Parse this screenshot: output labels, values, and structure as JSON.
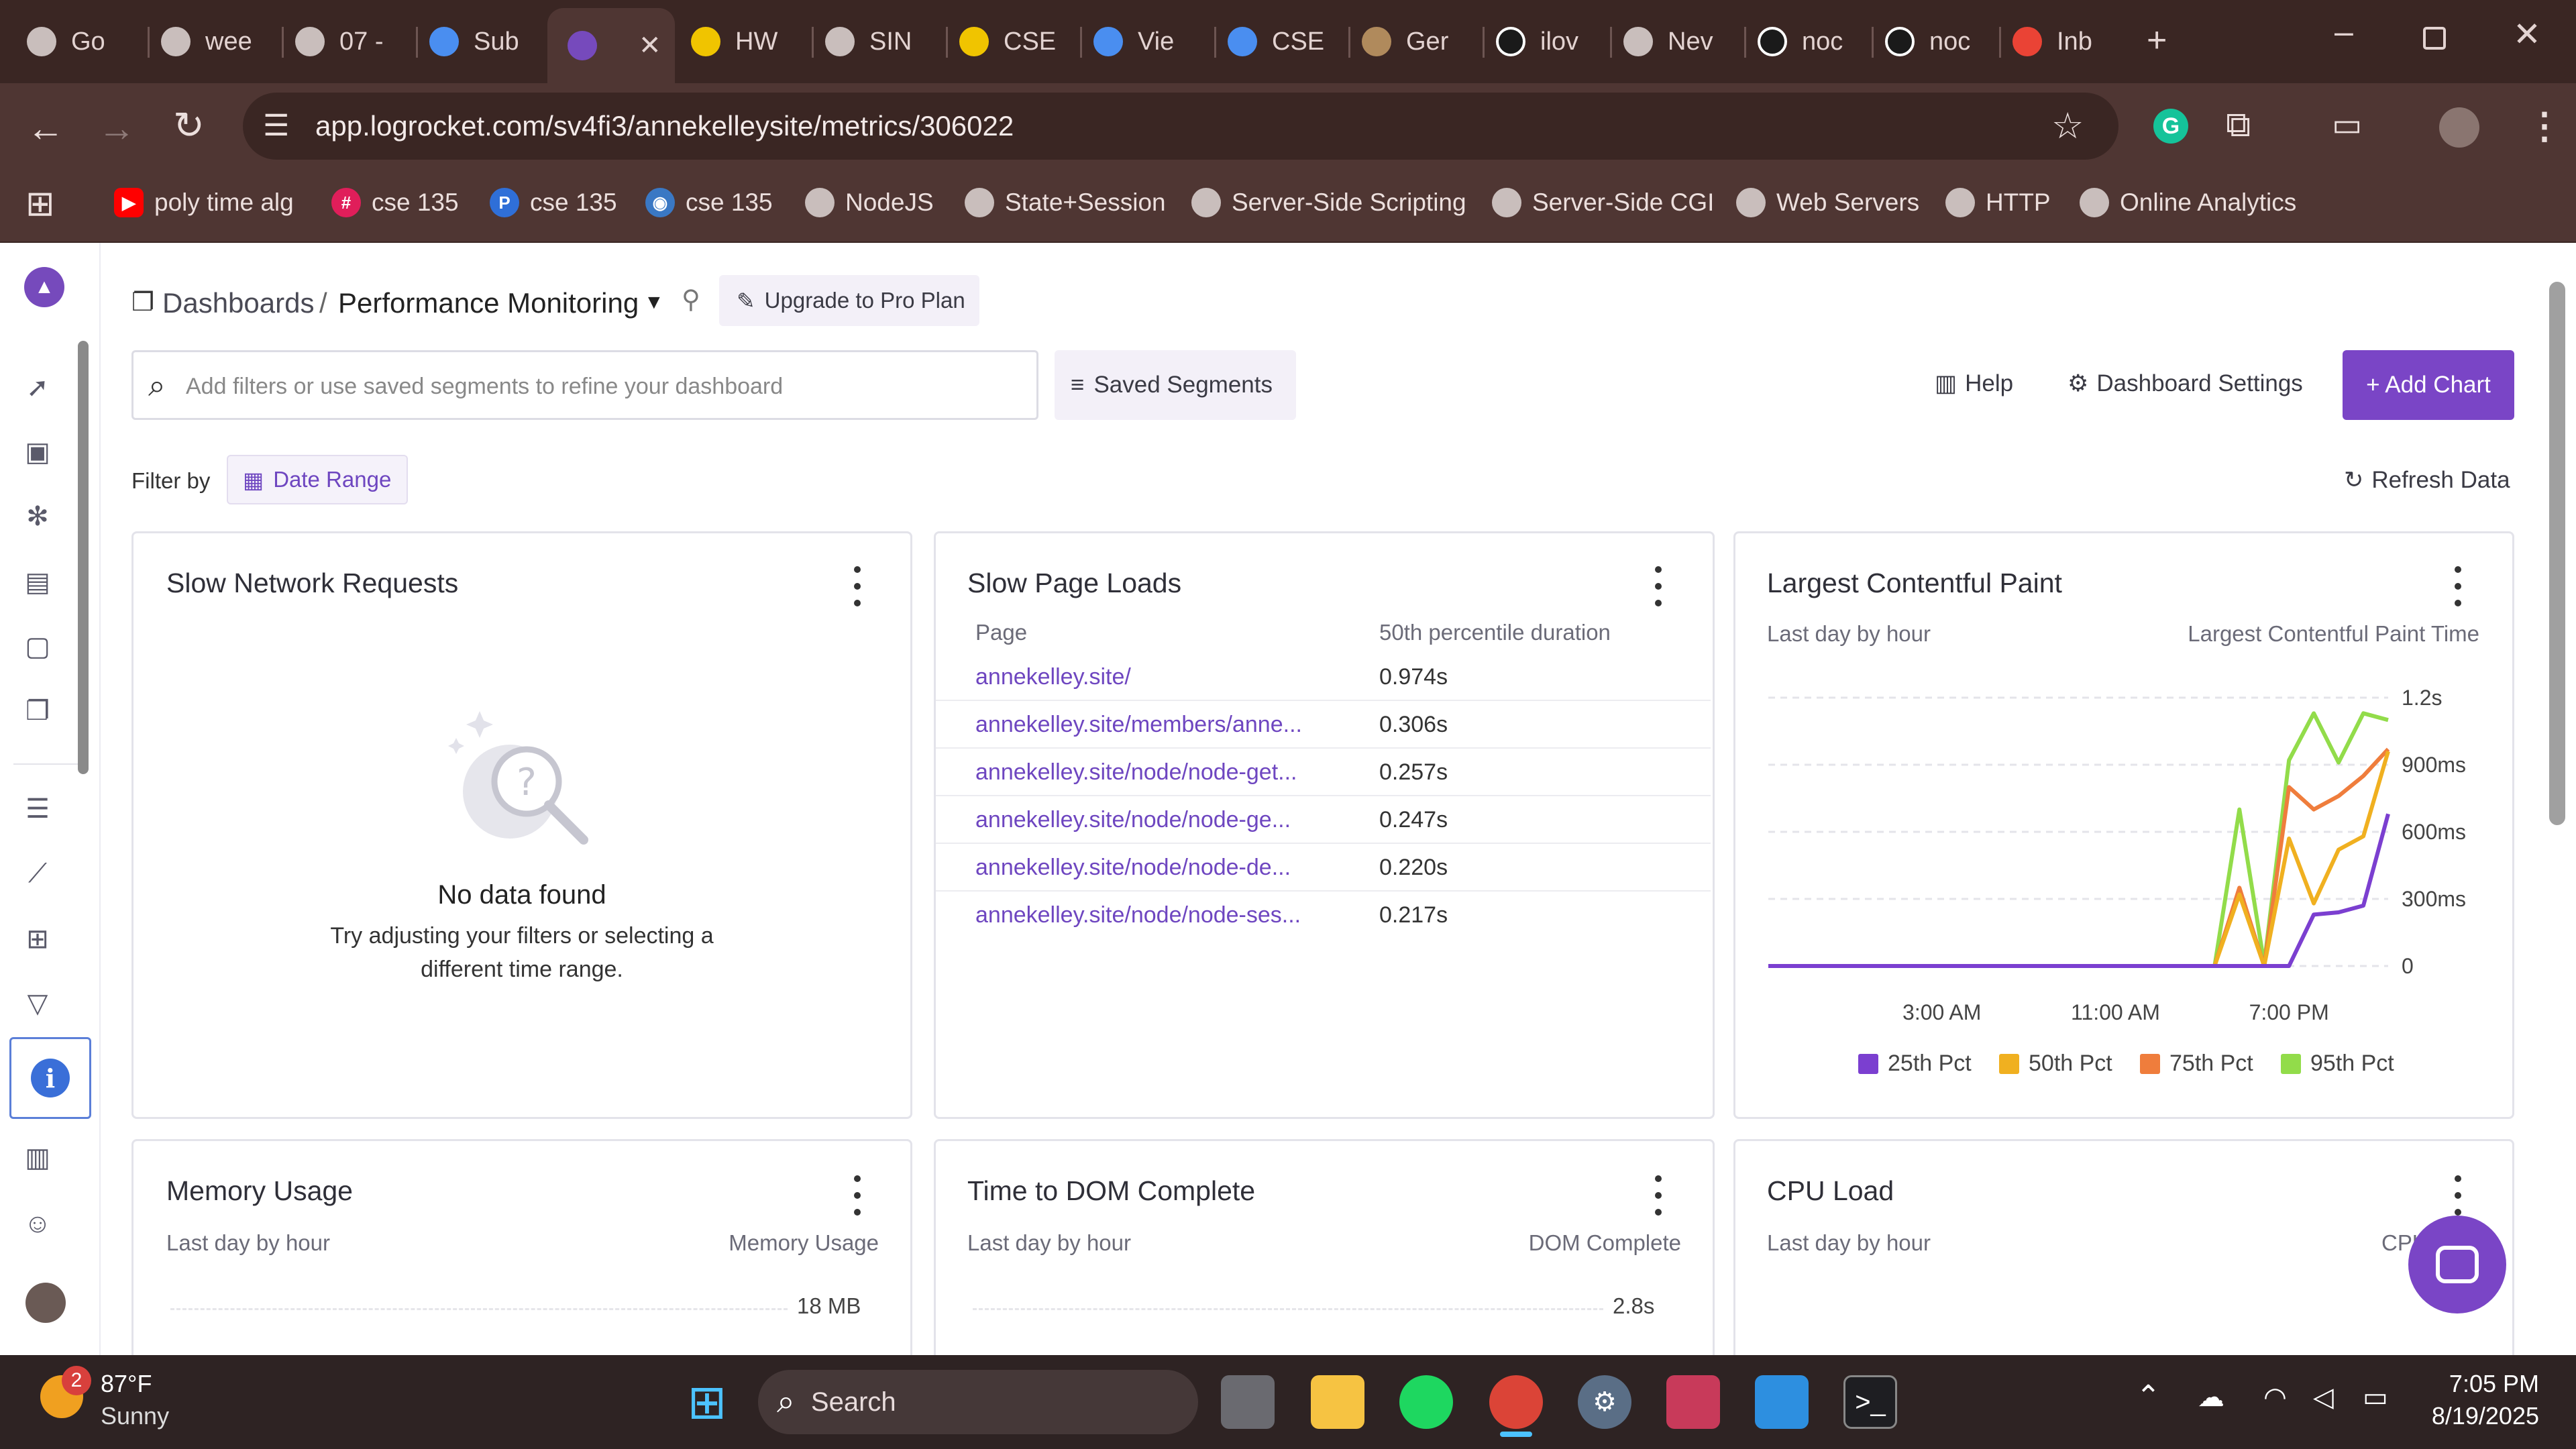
{
  "browser": {
    "tabs": [
      {
        "label": "Go",
        "icon": "globe-icon"
      },
      {
        "label": "wee",
        "icon": "globe-icon"
      },
      {
        "label": "07 -",
        "icon": "globe-icon"
      },
      {
        "label": "Sub",
        "icon": "bar-chart-icon"
      },
      {
        "label": "",
        "icon": "rocket-icon",
        "active": true
      },
      {
        "label": "HW",
        "icon": "stripes-icon"
      },
      {
        "label": "SIN",
        "icon": "globe-icon"
      },
      {
        "label": "CSE",
        "icon": "stripes-icon"
      },
      {
        "label": "Vie",
        "icon": "bar-chart-icon"
      },
      {
        "label": "CSE",
        "icon": "doc-icon"
      },
      {
        "label": "Ger",
        "icon": "image-icon"
      },
      {
        "label": "ilov",
        "icon": "github-icon"
      },
      {
        "label": "Nev",
        "icon": "chrome-icon"
      },
      {
        "label": "noc",
        "icon": "github-icon"
      },
      {
        "label": "noc",
        "icon": "github-icon"
      },
      {
        "label": "Inb",
        "icon": "gmail-icon"
      }
    ],
    "url": "app.logrocket.com/sv4fi3/annekelleysite/metrics/306022",
    "bookmarks": [
      {
        "label": "poly time alg",
        "icon": "youtube-icon"
      },
      {
        "label": "cse 135",
        "icon": "slack-icon"
      },
      {
        "label": "cse 135",
        "icon": "p-icon"
      },
      {
        "label": "cse 135",
        "icon": "site-icon"
      },
      {
        "label": "NodeJS",
        "icon": "globe-icon"
      },
      {
        "label": "State+Session",
        "icon": "globe-icon"
      },
      {
        "label": "Server-Side Scripting",
        "icon": "globe-icon"
      },
      {
        "label": "Server-Side CGI",
        "icon": "globe-icon"
      },
      {
        "label": "Web Servers",
        "icon": "globe-icon"
      },
      {
        "label": "HTTP",
        "icon": "globe-icon"
      },
      {
        "label": "Online Analytics",
        "icon": "globe-icon"
      }
    ]
  },
  "header": {
    "breadcrumb_root": "Dashboards",
    "breadcrumb_sep": "/",
    "dashboard_name": "Performance Monitoring",
    "upgrade_label": "Upgrade to Pro Plan",
    "search_placeholder": "Add filters or use saved segments to refine your dashboard",
    "saved_segments": "Saved Segments",
    "help": "Help",
    "settings": "Dashboard Settings",
    "add_chart": "+ Add Chart",
    "filter_by": "Filter by",
    "date_range": "Date Range",
    "refresh": "Refresh Data"
  },
  "cards": {
    "slow_network": {
      "title": "Slow Network Requests",
      "empty_title": "No data found",
      "empty_text_1": "Try adjusting your filters or selecting a",
      "empty_text_2": "different time range."
    },
    "slow_pages": {
      "title": "Slow Page Loads",
      "col_page": "Page",
      "col_duration": "50th percentile duration",
      "rows": [
        {
          "page": "annekelley.site/",
          "duration": "0.974s"
        },
        {
          "page": "annekelley.site/members/anne...",
          "duration": "0.306s"
        },
        {
          "page": "annekelley.site/node/node-get...",
          "duration": "0.257s"
        },
        {
          "page": "annekelley.site/node/node-ge...",
          "duration": "0.247s"
        },
        {
          "page": "annekelley.site/node/node-de...",
          "duration": "0.220s"
        },
        {
          "page": "annekelley.site/node/node-ses...",
          "duration": "0.217s"
        }
      ]
    },
    "lcp": {
      "title": "Largest Contentful Paint",
      "subtitle": "Last day by hour",
      "metric": "Largest Contentful Paint Time"
    },
    "memory": {
      "title": "Memory Usage",
      "subtitle": "Last day by hour",
      "metric": "Memory Usage",
      "top_tick": "18 MB"
    },
    "dom": {
      "title": "Time to DOM Complete",
      "subtitle": "Last day by hour",
      "metric": "DOM Complete",
      "top_tick": "2.8s"
    },
    "cpu": {
      "title": "CPU Load",
      "subtitle": "Last day by hour",
      "metric": "CPU"
    }
  },
  "chart_data": {
    "type": "line",
    "title": "Largest Contentful Paint",
    "y_ticks": [
      "0",
      "300ms",
      "600ms",
      "900ms",
      "1.2s"
    ],
    "ylim": [
      0,
      1200
    ],
    "x_ticks": [
      "3:00 AM",
      "11:00 AM",
      "7:00 PM"
    ],
    "x": [
      0,
      1,
      2,
      3,
      4,
      5,
      6,
      7,
      8,
      9,
      10,
      11,
      12,
      13,
      14,
      15,
      16,
      17,
      18,
      19,
      20,
      21,
      22,
      23,
      24,
      25
    ],
    "series": [
      {
        "name": "25th Pct",
        "color": "#7b3fd0",
        "values": [
          0,
          0,
          0,
          0,
          0,
          0,
          0,
          0,
          0,
          0,
          0,
          0,
          0,
          0,
          0,
          0,
          0,
          0,
          0,
          0,
          0,
          0,
          230,
          240,
          270,
          680
        ]
      },
      {
        "name": "50th Pct",
        "color": "#f0b020",
        "values": [
          0,
          0,
          0,
          0,
          0,
          0,
          0,
          0,
          0,
          0,
          0,
          0,
          0,
          0,
          0,
          0,
          0,
          0,
          0,
          320,
          0,
          570,
          280,
          520,
          580,
          960
        ]
      },
      {
        "name": "75th Pct",
        "color": "#ef7d3c",
        "values": [
          0,
          0,
          0,
          0,
          0,
          0,
          0,
          0,
          0,
          0,
          0,
          0,
          0,
          0,
          0,
          0,
          0,
          0,
          0,
          350,
          0,
          800,
          700,
          760,
          850,
          970
        ]
      },
      {
        "name": "95th Pct",
        "color": "#92dc4a",
        "values": [
          0,
          0,
          0,
          0,
          0,
          0,
          0,
          0,
          0,
          0,
          0,
          0,
          0,
          0,
          0,
          0,
          0,
          0,
          0,
          700,
          10,
          920,
          1130,
          910,
          1130,
          1100
        ]
      }
    ]
  },
  "taskbar": {
    "temp": "87°F",
    "weather": "Sunny",
    "badge": "2",
    "search": "Search",
    "time": "7:05 PM",
    "date": "8/19/2025"
  }
}
